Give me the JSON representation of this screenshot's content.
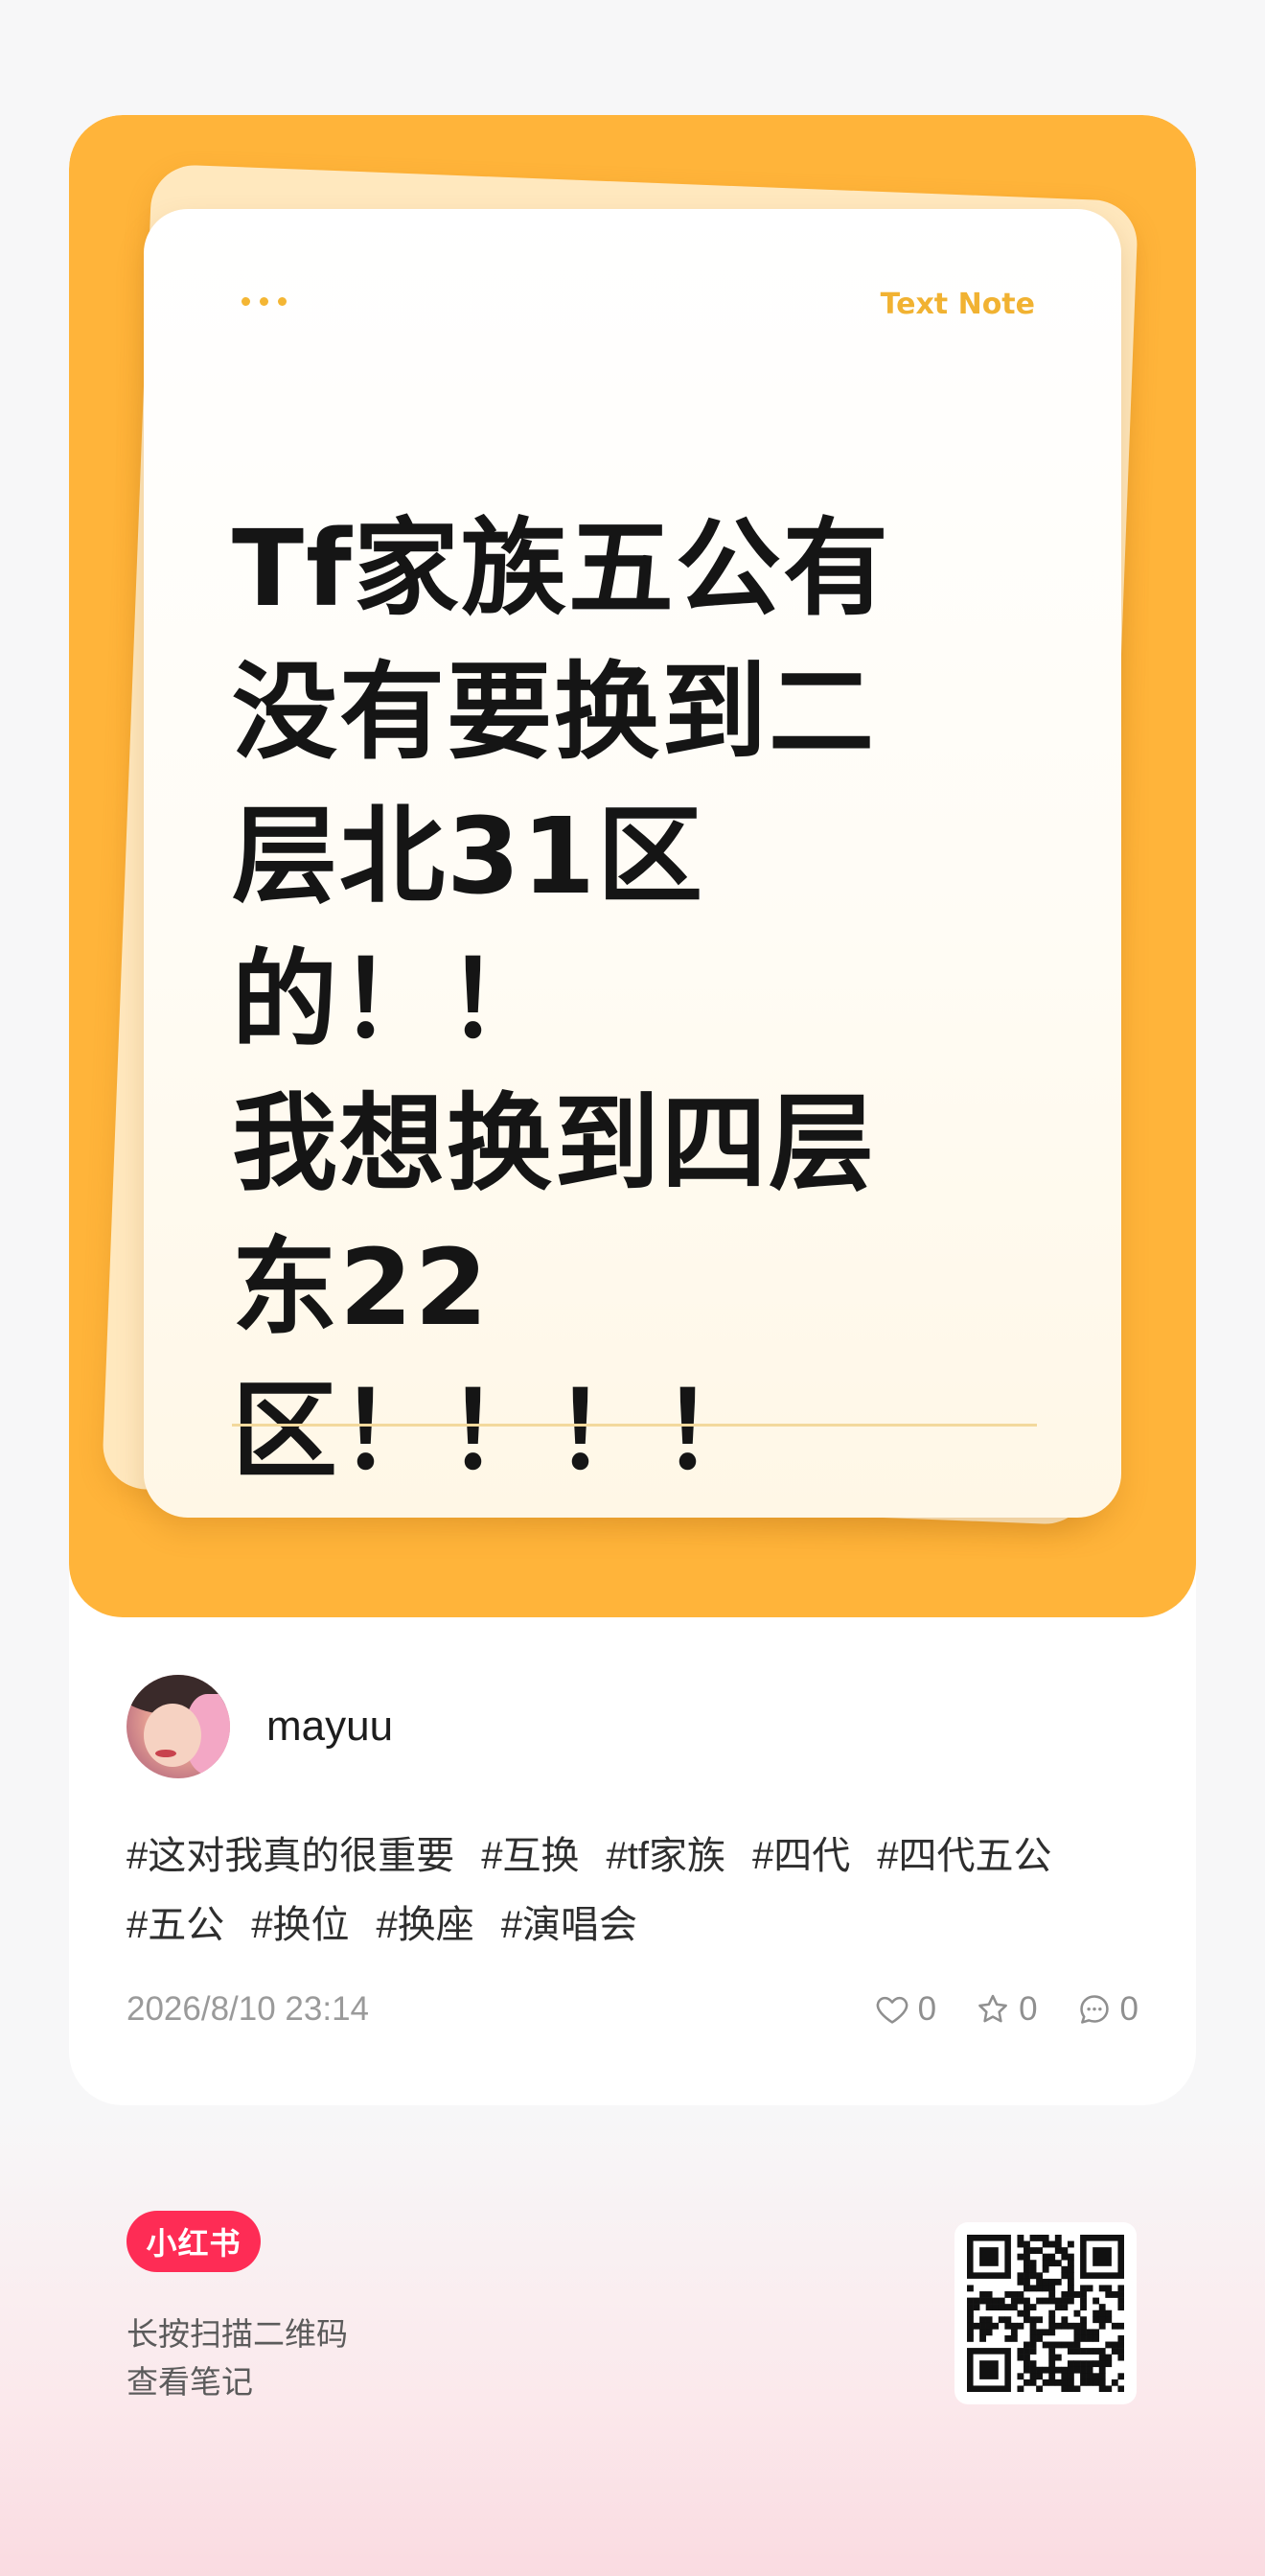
{
  "note": {
    "tag": "Text Note",
    "lines": [
      "Tf家族五公有",
      "没有要换到二",
      "层北31区的！！",
      "我想换到四层",
      "东22区！！！！"
    ]
  },
  "author": {
    "name": "mayuu"
  },
  "tags": [
    "#这对我真的很重要",
    "#互换",
    "#tf家族",
    "#四代",
    "#四代五公",
    "#五公",
    "#换位",
    "#换座",
    "#演唱会"
  ],
  "meta": {
    "date": "2026/8/10 23:14",
    "likes": "0",
    "collects": "0",
    "comments": "0"
  },
  "footer": {
    "logo": "小红书",
    "scan_line1": "长按扫描二维码",
    "scan_line2": "查看笔记"
  },
  "colors": {
    "cover_bg": "#ffb43a",
    "brand_red": "#fe2c55",
    "note_accent": "#f1b232"
  },
  "icons": {
    "like": "heart-icon",
    "collect": "star-icon",
    "comment": "comment-icon",
    "qr": "qr-code"
  }
}
